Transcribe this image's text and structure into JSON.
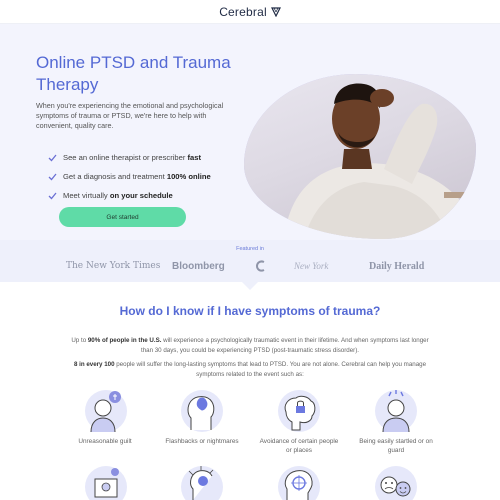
{
  "header": {
    "brand": "Cerebral",
    "logo_icon": "cerebral-triangle-icon"
  },
  "hero": {
    "title": "Online PTSD and Trauma Therapy",
    "subtitle": "When you're experiencing the emotional and psychological symptoms of trauma or PTSD, we're here to help with convenient, quality care.",
    "benefits": [
      {
        "text": "See an online therapist or prescriber ",
        "bold": "fast"
      },
      {
        "text": "Get a diagnosis and treatment ",
        "bold": "100% online"
      },
      {
        "text": "Meet virtually ",
        "bold": "on your schedule"
      }
    ],
    "cta_label": "Get started",
    "accent_color": "#5469d4",
    "cta_color": "#5fdba7"
  },
  "featured": {
    "label": "Featured in",
    "publications": [
      "The New York Times",
      "Bloomberg",
      "C",
      "New York",
      "Daily Herald"
    ]
  },
  "symptoms": {
    "title": "How do I know if I have symptoms of trauma?",
    "para1_lead": "Up to ",
    "para1_bold": "90% of people in the U.S.",
    "para1_rest": " will experience a psychologically traumatic event in their lifetime. And when symptoms last longer than 30 days, you could be experiencing PTSD (post-traumatic stress disorder).",
    "para2_bold": "8 in every 100",
    "para2_rest": " people will suffer the long-lasting symptoms that lead to PTSD. You are not alone. Cerebral can help you manage symptoms related to the event such as:",
    "items": [
      {
        "label": "Unreasonable guilt",
        "icon": "guilt-person-icon"
      },
      {
        "label": "Flashbacks or nightmares",
        "icon": "flashback-head-icon"
      },
      {
        "label": "Avoidance of certain people or places",
        "icon": "brain-lock-icon"
      },
      {
        "label": "Being easily startled or on guard",
        "icon": "startled-person-icon"
      }
    ]
  }
}
